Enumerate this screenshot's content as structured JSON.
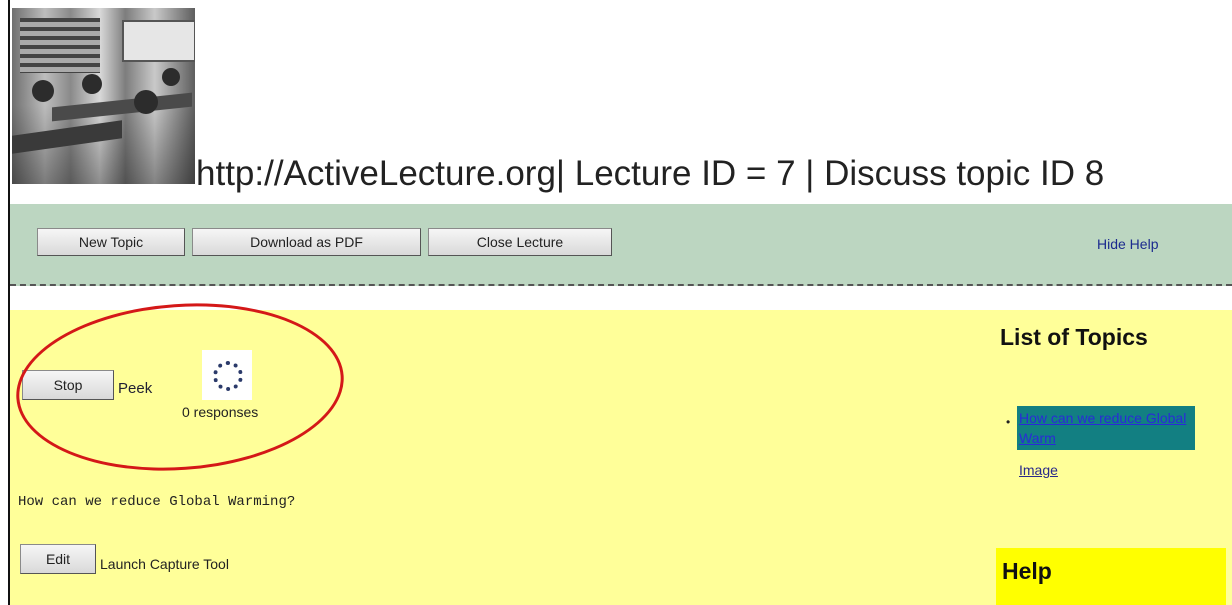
{
  "header": {
    "title": "http://ActiveLecture.org| Lecture ID = 7 | Discuss topic ID 8"
  },
  "toolbar": {
    "new_topic": "New Topic",
    "download_pdf": "Download as PDF",
    "close_lecture": "Close Lecture",
    "hide_help": "Hide Help",
    "bg_color": "#bcd6c1"
  },
  "main": {
    "stop": "Stop",
    "peek": "Peek",
    "responses": "0 responses",
    "question": "How can we reduce Global Warming?",
    "edit": "Edit",
    "launch_capture": "Launch Capture Tool",
    "bg_color": "#ffff99",
    "annotation_color": "#d41818"
  },
  "sidebar": {
    "heading": "List of Topics",
    "bullet": "•",
    "topics": [
      {
        "label": "How can we reduce Global Warm"
      }
    ],
    "image_link": "Image",
    "help_heading": "Help",
    "help_bg": "#ffff00"
  }
}
